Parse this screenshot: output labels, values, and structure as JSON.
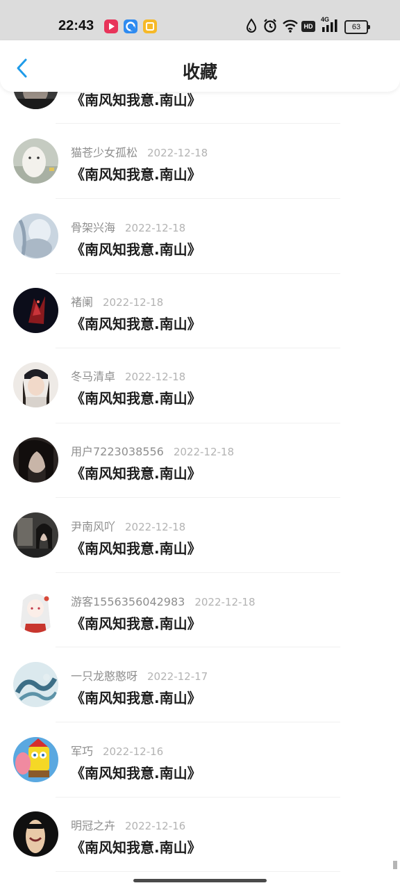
{
  "status_bar": {
    "time": "22:43",
    "battery": "63",
    "hd_label": "HD",
    "network_label": "4G",
    "app_icons": [
      "video-app-icon",
      "browser-app-icon",
      "notes-app-icon"
    ],
    "right_icons": [
      "water-drop-icon",
      "alarm-icon",
      "wifi-icon",
      "signal-icon"
    ]
  },
  "header": {
    "title": "收藏",
    "back_icon": "chevron-left-icon"
  },
  "colors": {
    "accent": "#1f9be9",
    "status_bar_bg": "#dcdcdc",
    "username": "#8e8e8e",
    "date": "#b3b3b3"
  },
  "favorites": [
    {
      "user": "",
      "date": "",
      "title": "《南风知我意.南山》"
    },
    {
      "user": "猫苍少女孤松",
      "date": "2022-12-18",
      "title": "《南风知我意.南山》"
    },
    {
      "user": "骨架兴海",
      "date": "2022-12-18",
      "title": "《南风知我意.南山》"
    },
    {
      "user": "褚阑",
      "date": "2022-12-18",
      "title": "《南风知我意.南山》"
    },
    {
      "user": "冬马清卓",
      "date": "2022-12-18",
      "title": "《南风知我意.南山》"
    },
    {
      "user": "用户7223038556",
      "date": "2022-12-18",
      "title": "《南风知我意.南山》"
    },
    {
      "user": "尹南风吖",
      "date": "2022-12-18",
      "title": "《南风知我意.南山》"
    },
    {
      "user": "游客1556356042983",
      "date": "2022-12-18",
      "title": "《南风知我意.南山》"
    },
    {
      "user": "一只龙憨憨呀",
      "date": "2022-12-17",
      "title": "《南风知我意.南山》"
    },
    {
      "user": "军巧",
      "date": "2022-12-16",
      "title": "《南风知我意.南山》"
    },
    {
      "user": "明冠之卉",
      "date": "2022-12-16",
      "title": "《南风知我意.南山》"
    }
  ]
}
